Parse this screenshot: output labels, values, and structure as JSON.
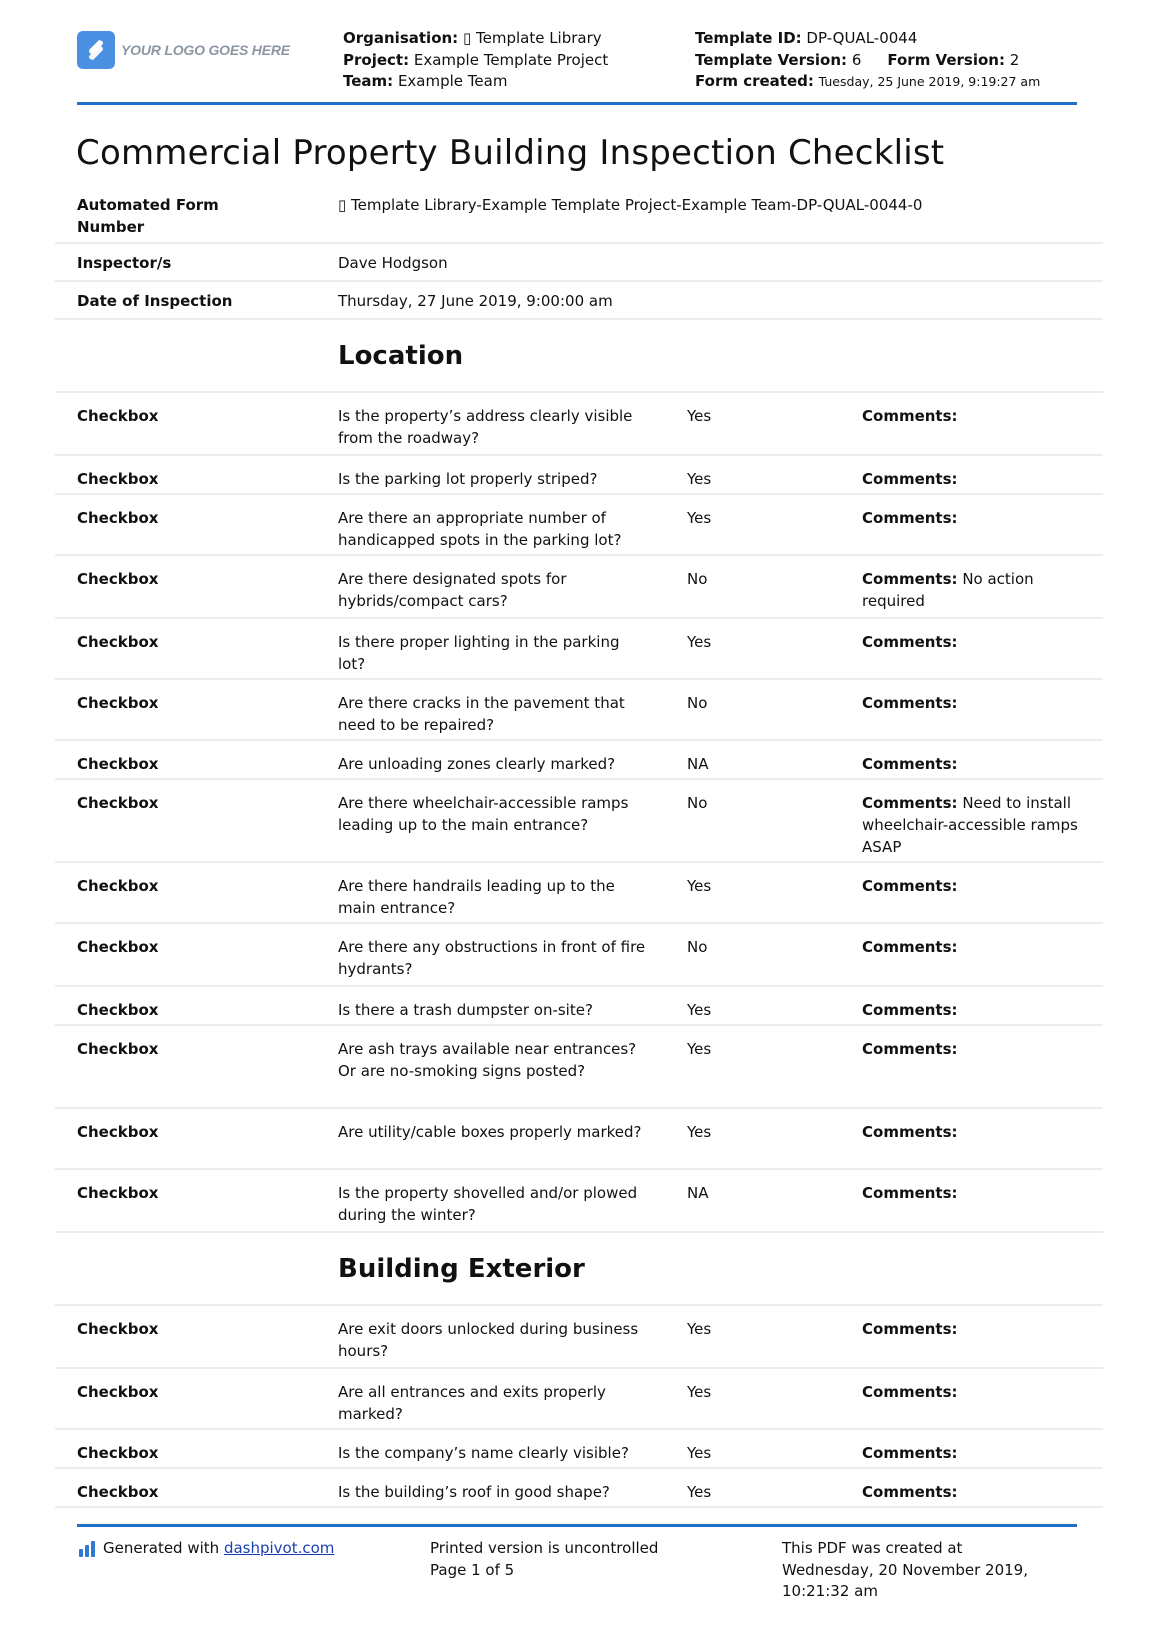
{
  "header": {
    "logo_text": "YOUR LOGO GOES HERE",
    "organisation_label": "Organisation:",
    "organisation_value": "▯ Template Library",
    "project_label": "Project:",
    "project_value": "Example Template Project",
    "team_label": "Team:",
    "team_value": "Example Team",
    "template_id_label": "Template ID:",
    "template_id_value": "DP-QUAL-0044",
    "template_version_label": "Template Version:",
    "template_version_value": "6",
    "form_version_label": "Form Version:",
    "form_version_value": "2",
    "form_created_label": "Form created:",
    "form_created_value": "Tuesday, 25 June 2019, 9:19:27 am"
  },
  "title": "Commercial Property Building Inspection Checklist",
  "info": [
    {
      "label": "Automated Form Number",
      "value": "▯ Template Library-Example Template Project-Example Team-DP-QUAL-0044-0"
    },
    {
      "label": "Inspector/s",
      "value": "Dave Hodgson"
    },
    {
      "label": "Date of Inspection",
      "value": "Thursday, 27 June 2019, 9:00:00 am"
    }
  ],
  "comments_label": "Comments:",
  "sections": [
    {
      "title": "Location",
      "items": [
        {
          "type": "Checkbox",
          "question": "Is the property’s address clearly visible from the roadway?",
          "answer": "Yes",
          "comment": ""
        },
        {
          "type": "Checkbox",
          "question": "Is the parking lot properly striped?",
          "answer": "Yes",
          "comment": ""
        },
        {
          "type": "Checkbox",
          "question": "Are there an appropriate number of handicapped spots in the parking lot?",
          "answer": "Yes",
          "comment": ""
        },
        {
          "type": "Checkbox",
          "question": "Are there designated spots for hybrids/compact cars?",
          "answer": "No",
          "comment": "No action required"
        },
        {
          "type": "Checkbox",
          "question": "Is there proper lighting in the parking lot?",
          "answer": "Yes",
          "comment": ""
        },
        {
          "type": "Checkbox",
          "question": "Are there cracks in the pavement that need to be repaired?",
          "answer": "No",
          "comment": ""
        },
        {
          "type": "Checkbox",
          "question": "Are unloading zones clearly marked?",
          "answer": "NA",
          "comment": ""
        },
        {
          "type": "Checkbox",
          "question": "Are there wheelchair-accessible ramps leading up to the main entrance?",
          "answer": "No",
          "comment": "Need to install wheelchair-accessible ramps ASAP"
        },
        {
          "type": "Checkbox",
          "question": "Are there handrails leading up to the main entrance?",
          "answer": "Yes",
          "comment": ""
        },
        {
          "type": "Checkbox",
          "question": "Are there any obstructions in front of fire hydrants?",
          "answer": "No",
          "comment": ""
        },
        {
          "type": "Checkbox",
          "question": "Is there a trash dumpster on-site?",
          "answer": "Yes",
          "comment": ""
        },
        {
          "type": "Checkbox",
          "question": "Are ash trays available near entrances? Or are no-smoking signs posted?",
          "answer": "Yes",
          "comment": ""
        },
        {
          "type": "Checkbox",
          "question": "Are utility/cable boxes properly marked?",
          "answer": "Yes",
          "comment": ""
        },
        {
          "type": "Checkbox",
          "question": "Is the property shovelled and/or plowed during the winter?",
          "answer": "NA",
          "comment": ""
        }
      ]
    },
    {
      "title": "Building Exterior",
      "items": [
        {
          "type": "Checkbox",
          "question": "Are exit doors unlocked during business hours?",
          "answer": "Yes",
          "comment": ""
        },
        {
          "type": "Checkbox",
          "question": "Are all entrances and exits properly marked?",
          "answer": "Yes",
          "comment": ""
        },
        {
          "type": "Checkbox",
          "question": "Is the company’s name clearly visible?",
          "answer": "Yes",
          "comment": ""
        },
        {
          "type": "Checkbox",
          "question": "Is the building’s roof in good shape?",
          "answer": "Yes",
          "comment": ""
        }
      ]
    }
  ],
  "footer": {
    "generated_prefix": "Generated with",
    "generated_link": "dashpivot.com",
    "uncontrolled": "Printed version is uncontrolled",
    "page": "Page 1 of 5",
    "pdf_created_line1": "This PDF was created at",
    "pdf_created_line2": "Wednesday, 20 November 2019,",
    "pdf_created_line3": "10:21:32 am"
  },
  "colors": {
    "accent": "#1f6fc9",
    "logo": "#4a90e2",
    "link": "#1a3fb4",
    "divider": "#ececec"
  }
}
